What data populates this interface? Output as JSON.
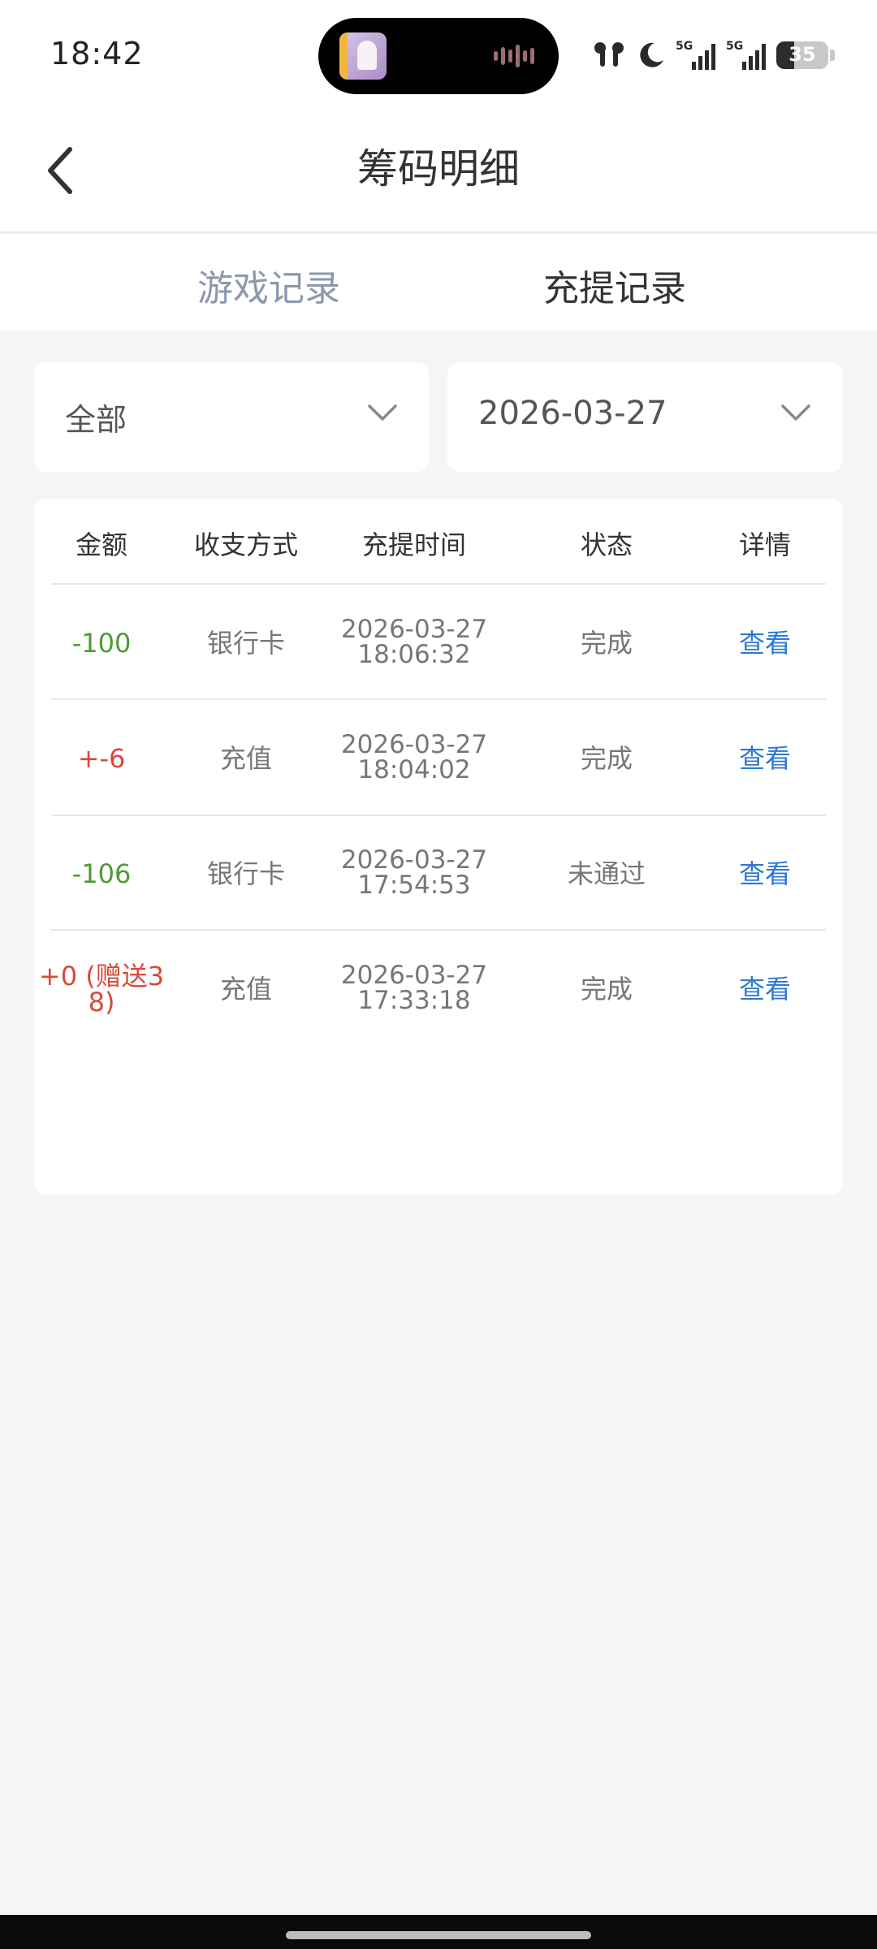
{
  "status_bar": {
    "time": "18:42",
    "signal_1": "5G",
    "signal_2": "5G",
    "battery": "35"
  },
  "header": {
    "title": "筹码明细"
  },
  "tabs": [
    {
      "label": "游戏记录",
      "active": false
    },
    {
      "label": "充提记录",
      "active": true
    }
  ],
  "filters": {
    "type_value": "全部",
    "date_value": "2026-03-27"
  },
  "table": {
    "headers": [
      "金额",
      "收支方式",
      "充提时间",
      "状态",
      "详情"
    ],
    "rows": [
      {
        "amount_l1": "-100",
        "amount_l2": "",
        "sign": "neg",
        "method": "银行卡",
        "date": "2026-03-27",
        "time": "18:06:32",
        "status": "完成",
        "detail": "查看"
      },
      {
        "amount_l1": "+-6",
        "amount_l2": "",
        "sign": "pos",
        "method": "充值",
        "date": "2026-03-27",
        "time": "18:04:02",
        "status": "完成",
        "detail": "查看"
      },
      {
        "amount_l1": "-106",
        "amount_l2": "",
        "sign": "neg",
        "method": "银行卡",
        "date": "2026-03-27",
        "time": "17:54:53",
        "status": "未通过",
        "detail": "查看"
      },
      {
        "amount_l1": "+0 (赠送3",
        "amount_l2": "8)",
        "sign": "pos",
        "method": "充值",
        "date": "2026-03-27",
        "time": "17:33:18",
        "status": "完成",
        "detail": "查看"
      }
    ]
  },
  "colors": {
    "negative": "#4f9a35",
    "positive": "#d9493a",
    "link": "#2c78d4",
    "inactive_tab": "#8c98ad"
  }
}
